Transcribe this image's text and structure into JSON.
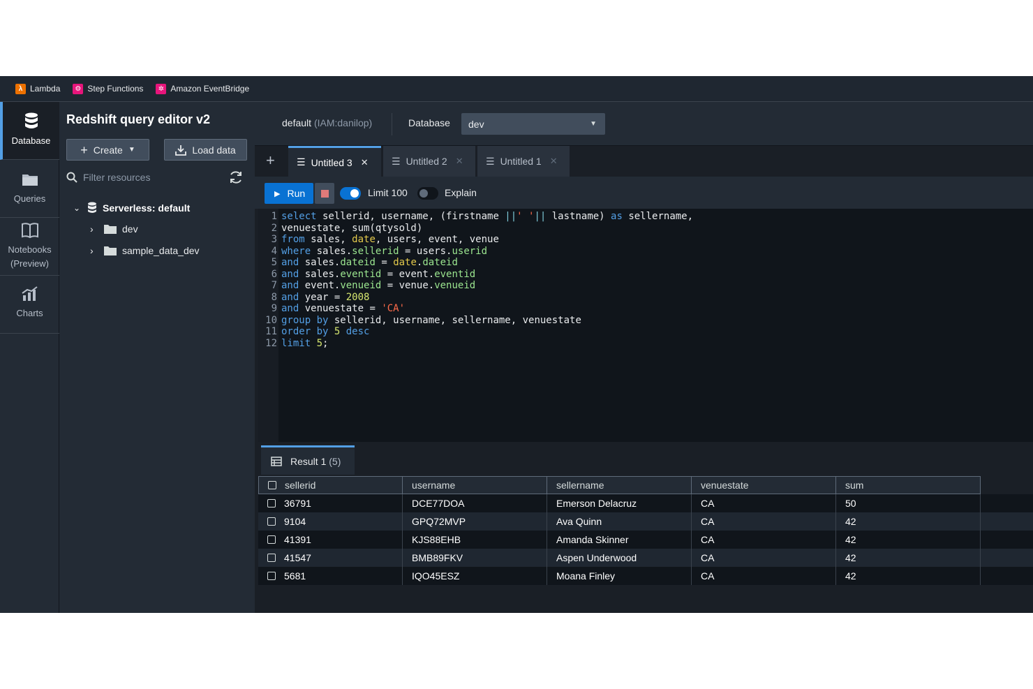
{
  "favorites": [
    {
      "label": "Lambda",
      "color": "#ed7100"
    },
    {
      "label": "Step Functions",
      "color": "#e7157b"
    },
    {
      "label": "Amazon EventBridge",
      "color": "#e7157b"
    }
  ],
  "rail": [
    {
      "label": "Database",
      "icon": "database-icon"
    },
    {
      "label": "Queries",
      "icon": "folder-icon"
    },
    {
      "label": "Notebooks (Preview)",
      "icon": "book-icon"
    },
    {
      "label": "Charts",
      "icon": "chart-icon"
    }
  ],
  "panel": {
    "title": "Redshift query editor v2",
    "create_label": "Create",
    "load_label": "Load data",
    "filter_placeholder": "Filter resources",
    "tree": [
      {
        "label": "Serverless: default"
      },
      {
        "label": "dev"
      },
      {
        "label": "sample_data_dev"
      }
    ]
  },
  "context": {
    "connection": "default",
    "connection_role": "(IAM:danilop)",
    "database_label": "Database",
    "database_value": "dev"
  },
  "tabs": [
    {
      "label": "Untitled 3"
    },
    {
      "label": "Untitled 2"
    },
    {
      "label": "Untitled 1"
    }
  ],
  "toolbar": {
    "run_label": "Run",
    "limit_label": "Limit 100",
    "explain_label": "Explain"
  },
  "editor": {
    "line_numbers": [
      "1",
      "2",
      "3",
      "4",
      "5",
      "6",
      "7",
      "8",
      "9",
      "10",
      "11",
      "12"
    ]
  },
  "results": {
    "tab_label": "Result 1",
    "tab_count": "(5)",
    "columns": [
      "sellerid",
      "username",
      "sellername",
      "venuestate",
      "sum"
    ],
    "rows": [
      [
        "36791",
        "DCE77DOA",
        "Emerson Delacruz",
        "CA",
        "50"
      ],
      [
        "9104",
        "GPQ72MVP",
        "Ava Quinn",
        "CA",
        "42"
      ],
      [
        "41391",
        "KJS88EHB",
        "Amanda Skinner",
        "CA",
        "42"
      ],
      [
        "41547",
        "BMB89FKV",
        "Aspen Underwood",
        "CA",
        "42"
      ],
      [
        "5681",
        "IQO45ESZ",
        "Moana Finley",
        "CA",
        "42"
      ]
    ]
  },
  "colors": {
    "accent": "#539fe5",
    "primary_button": "#0972d3"
  }
}
